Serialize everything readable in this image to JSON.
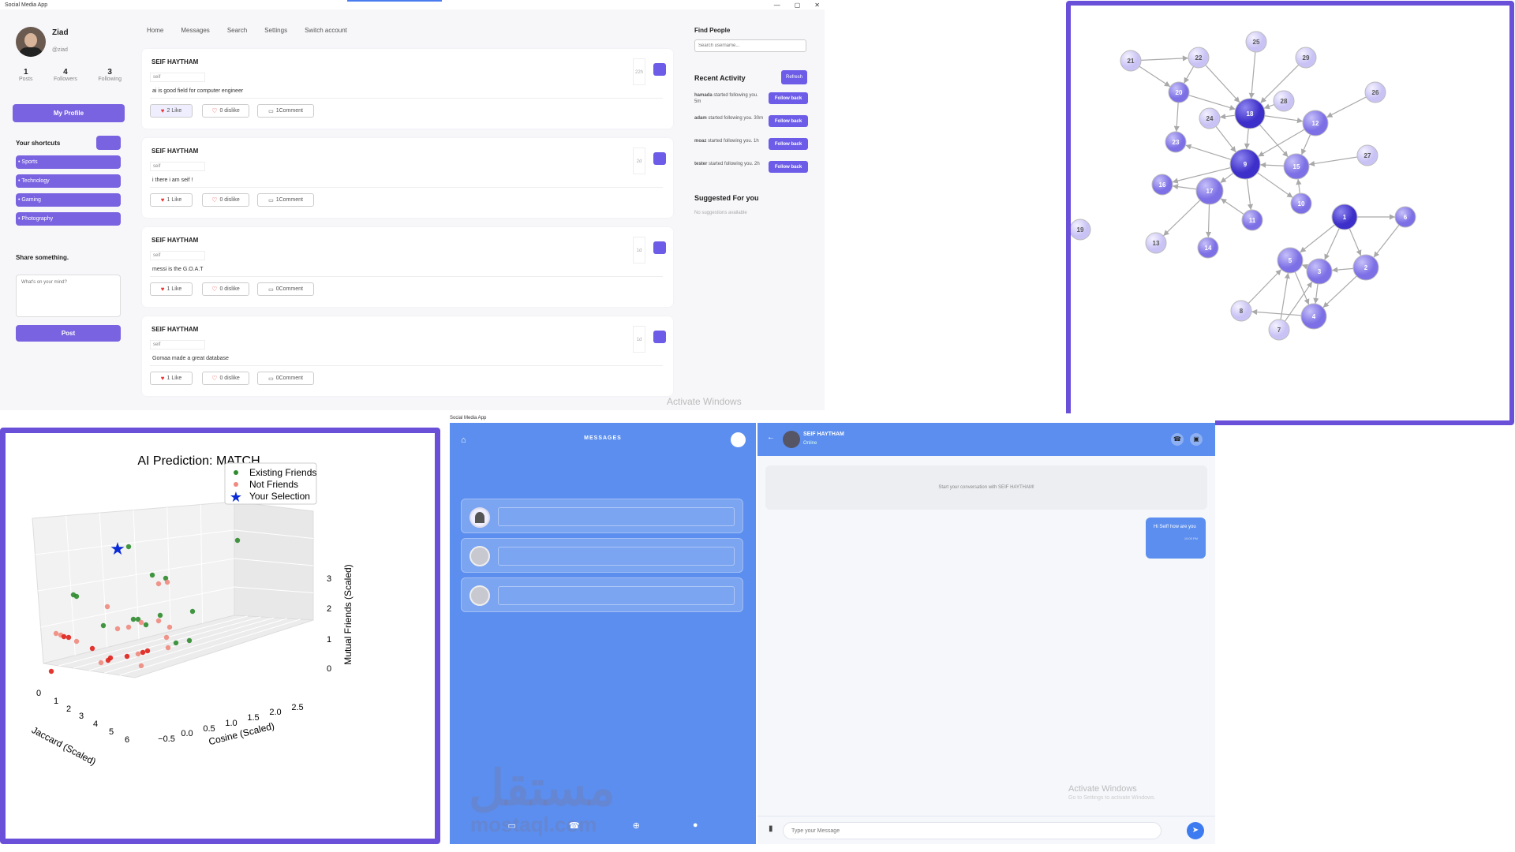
{
  "window": {
    "title": "Social Media App"
  },
  "profile": {
    "name": "Ziad",
    "handle": "@ziad",
    "stats": [
      {
        "value": "1",
        "label": "Posts"
      },
      {
        "value": "4",
        "label": "Followers"
      },
      {
        "value": "3",
        "label": "Following"
      }
    ],
    "my_profile_label": "My Profile"
  },
  "nav": [
    "Home",
    "Messages",
    "Search",
    "Settings",
    "Switch account"
  ],
  "shortcuts": {
    "title": "Your shortcuts",
    "items": [
      "• Sports",
      "• Technology",
      "• Gaming",
      "• Photography"
    ]
  },
  "share": {
    "title": "Share something.",
    "placeholder": "What's on your mind?",
    "post_label": "Post"
  },
  "posts": [
    {
      "author": "SEIF HAYTHAM",
      "sub": "seif",
      "text": "ai is good field for computer engineer",
      "time": "22h",
      "like": "2 Like",
      "dislike": "0 dislike",
      "comment": "1Comment"
    },
    {
      "author": "SEIF HAYTHAM",
      "sub": "seif",
      "text": "i there i am seif !",
      "time": "2d",
      "like": "1 Like",
      "dislike": "0 dislike",
      "comment": "1Comment"
    },
    {
      "author": "SEIF HAYTHAM",
      "sub": "seif",
      "text": "messi is the G.O.A.T",
      "time": "1d",
      "like": "1 Like",
      "dislike": "0 dislike",
      "comment": "0Comment"
    },
    {
      "author": "SEIF HAYTHAM",
      "sub": "seif",
      "text": "Gomaa made a great database",
      "time": "1d",
      "like": "1 Like",
      "dislike": "0 dislike",
      "comment": "0Comment"
    }
  ],
  "right": {
    "find_title": "Find People",
    "search_placeholder": "Search username...",
    "activity_title": "Recent Activity",
    "refresh_label": "Refresh",
    "activities": [
      {
        "user": "hamada",
        "text": "started following you. 5m",
        "btn": "Follow back"
      },
      {
        "user": "adam",
        "text": "started following you. 30m",
        "btn": "Follow back"
      },
      {
        "user": "moaz",
        "text": "started following you. 1h",
        "btn": "Follow back"
      },
      {
        "user": "tester",
        "text": "started following you. 2h",
        "btn": "Follow back"
      }
    ],
    "suggested_title": "Suggested For you",
    "suggested_empty": "No suggestions available"
  },
  "watermark": {
    "title": "Activate Windows",
    "sub": "Go to Settings to activate Windows."
  },
  "graph": {
    "nodes": [
      "1",
      "2",
      "3",
      "4",
      "5",
      "6",
      "7",
      "8",
      "9",
      "10",
      "11",
      "12",
      "13",
      "14",
      "15",
      "16",
      "17",
      "18",
      "19",
      "20",
      "21",
      "22",
      "23",
      "24",
      "25",
      "26",
      "27",
      "28",
      "29"
    ],
    "colors": {
      "dark": "#4b3fd6",
      "mid": "#8f85ec",
      "light": "#d8d4fb",
      "edge": "#a9a9a9"
    }
  },
  "chart_data": {
    "type": "scatter",
    "title": "AI Prediction: MATCH",
    "xlabel": "Jaccard (Scaled)",
    "ylabel": "Cosine (Scaled)",
    "zlabel": "Mutual Friends (Scaled)",
    "xticks": [
      "0",
      "1",
      "2",
      "3",
      "4",
      "5",
      "6"
    ],
    "yticks": [
      "−0.5",
      "0.0",
      "0.5",
      "1.0",
      "1.5",
      "2.0",
      "2.5"
    ],
    "zticks": [
      "0",
      "1",
      "2",
      "3"
    ],
    "legend": [
      "Existing Friends",
      "Not Friends",
      "Your Selection"
    ],
    "legend_placement": "top-right",
    "colors": {
      "friends": "#2e8b2e",
      "not_friends": "#f08a7e",
      "selection": "#0a2bd6"
    }
  },
  "messages": {
    "app_title": "Social Media App",
    "header": "MESSAGES",
    "contact_name": "SEIF HAYTHAM",
    "contact_status": "Online",
    "empty_text": "Start your conversation with SEIF HAYTHAM!",
    "bubble_text": "Hi Seif! how are you",
    "bubble_time": "10:05 PM",
    "input_placeholder": "Type your Message"
  },
  "brand_watermark": {
    "arabic": "مستقل",
    "latin": "mostaql.com"
  }
}
